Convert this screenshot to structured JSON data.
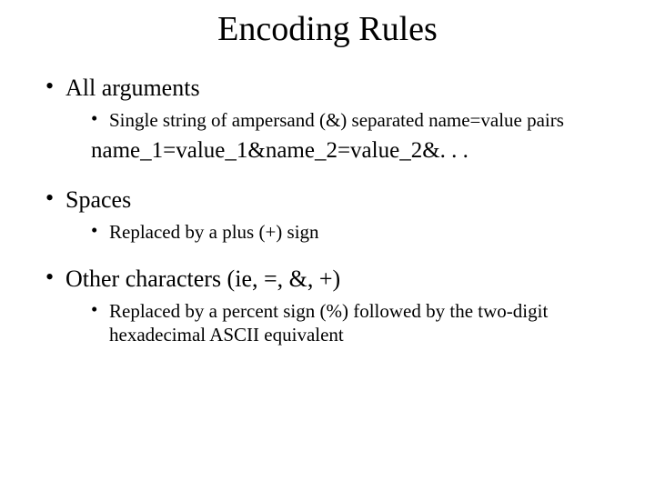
{
  "title": "Encoding Rules",
  "bullets": [
    {
      "label": "All arguments",
      "sub": [
        "Single string of ampersand (&) separated name=value pairs"
      ],
      "example": "name_1=value_1&name_2=value_2&. . ."
    },
    {
      "label": "Spaces",
      "sub": [
        "Replaced by a plus (+) sign"
      ]
    },
    {
      "label": "Other characters (ie, =, &, +)",
      "sub": [
        "Replaced by a percent sign (%) followed by the two-digit hexadecimal ASCII equivalent"
      ]
    }
  ]
}
